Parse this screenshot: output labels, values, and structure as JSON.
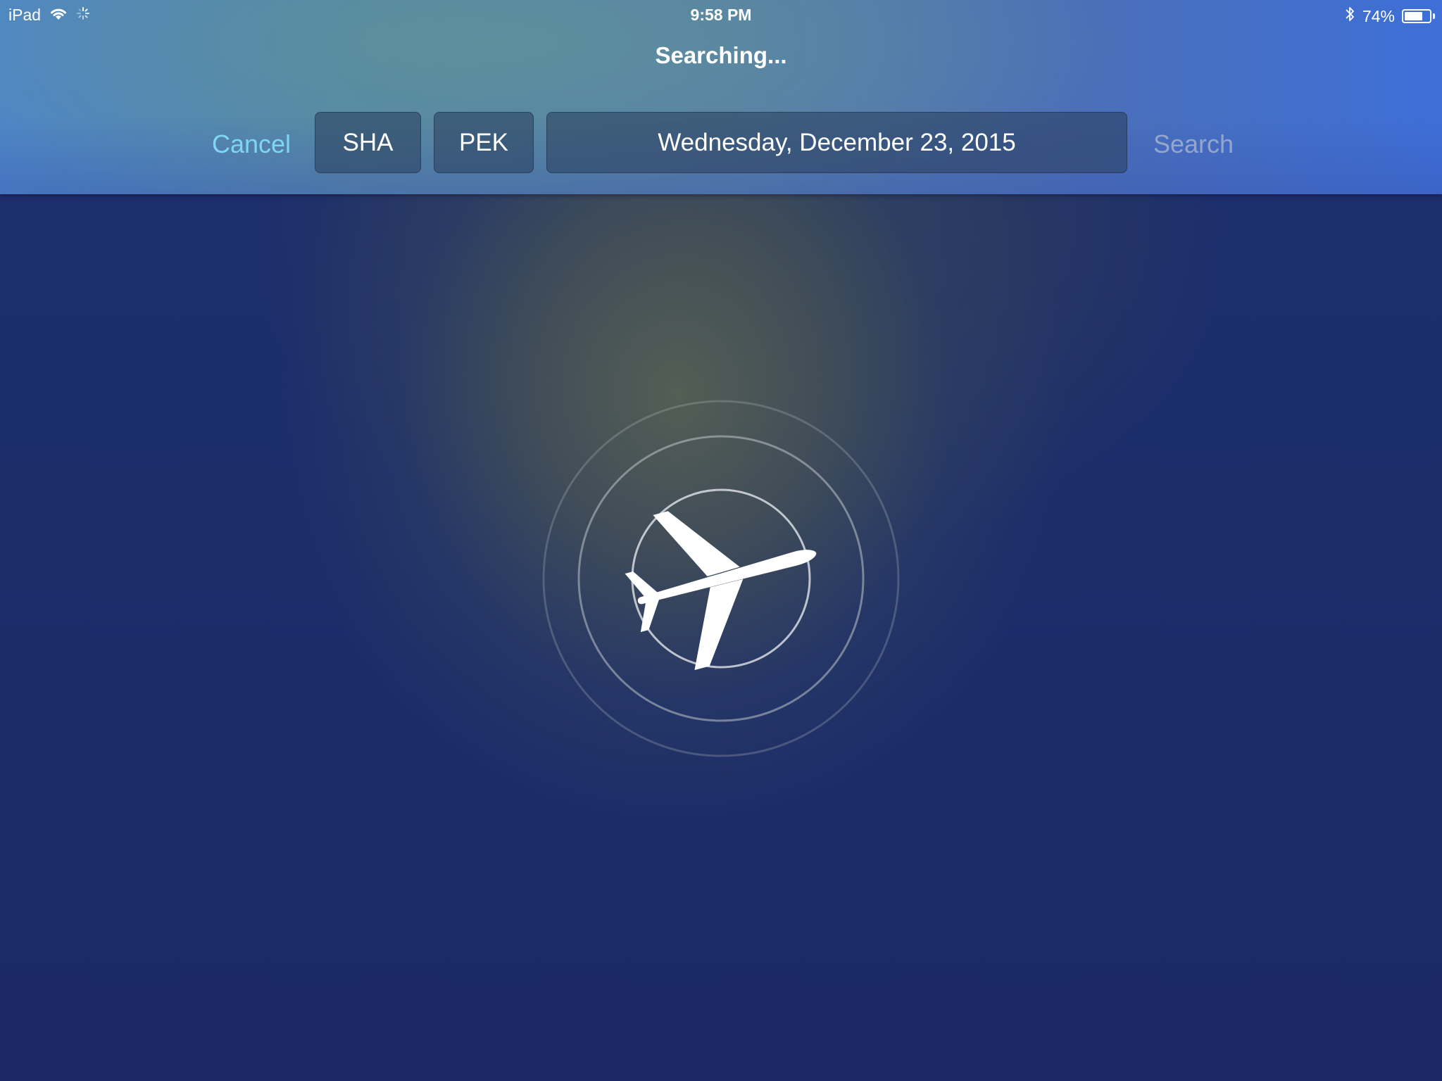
{
  "status_bar": {
    "device": "iPad",
    "time": "9:58 PM",
    "battery_percent": "74%",
    "battery_level": 0.74,
    "icons": [
      "wifi-icon",
      "activity-spinner-icon",
      "bluetooth-icon",
      "battery-icon"
    ]
  },
  "header": {
    "title": "Searching...",
    "cancel_label": "Cancel",
    "origin": "SHA",
    "destination": "PEK",
    "date": "Wednesday, December 23, 2015",
    "search_label": "Search"
  },
  "main": {
    "loading_icon": "airplane-icon",
    "indicator": "radar-rings"
  },
  "colors": {
    "cancel": "#7fd6f2",
    "search_disabled": "#9aa3b5",
    "background": "#1c2d6a",
    "header": "#5486a8"
  }
}
